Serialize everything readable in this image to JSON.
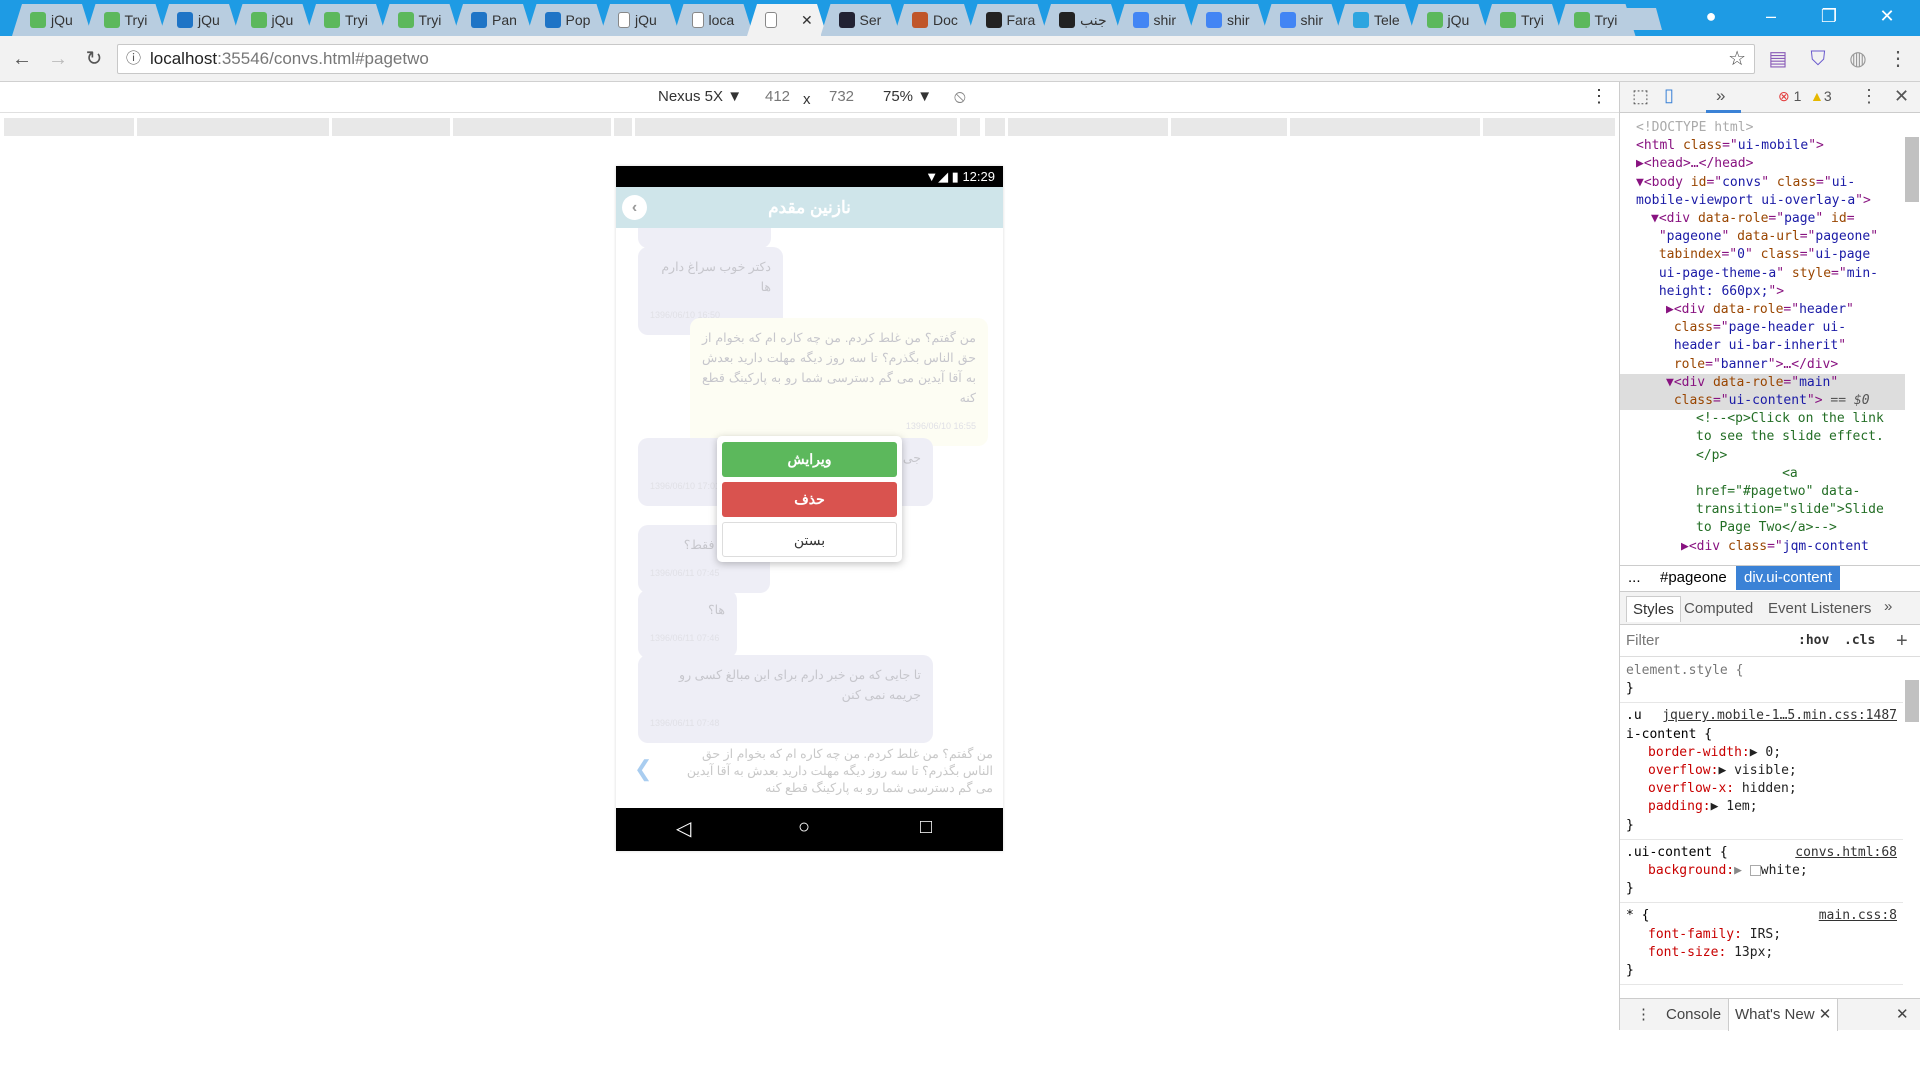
{
  "browser": {
    "tabs": [
      {
        "label": "jQu",
        "icon": "w3",
        "color": "#5cb85c"
      },
      {
        "label": "Tryi",
        "icon": "w3",
        "color": "#5cb85c"
      },
      {
        "label": "jQu",
        "icon": "jquery",
        "color": "#1e74c6"
      },
      {
        "label": "jQu",
        "icon": "w3",
        "color": "#5cb85c"
      },
      {
        "label": "Tryi",
        "icon": "w3",
        "color": "#5cb85c"
      },
      {
        "label": "Tryi",
        "icon": "w3",
        "color": "#5cb85c"
      },
      {
        "label": "Pan",
        "icon": "jquery",
        "color": "#1e74c6"
      },
      {
        "label": "Pop",
        "icon": "jquery",
        "color": "#1e74c6"
      },
      {
        "label": "jQu",
        "icon": "page",
        "color": "#888"
      },
      {
        "label": "loca",
        "icon": "page",
        "color": "#888"
      },
      {
        "label": "",
        "icon": "page",
        "color": "#888",
        "active": true
      },
      {
        "label": "Ser",
        "icon": "sentry",
        "color": "#223"
      },
      {
        "label": "Doc",
        "icon": "doc",
        "color": "#c0562a"
      },
      {
        "label": "Fara",
        "icon": "eye",
        "color": "#222"
      },
      {
        "label": "جنب",
        "icon": "eye",
        "color": "#222"
      },
      {
        "label": "shir",
        "icon": "google",
        "color": "#4285f4"
      },
      {
        "label": "shir",
        "icon": "google",
        "color": "#4285f4"
      },
      {
        "label": "shir",
        "icon": "google",
        "color": "#4285f4"
      },
      {
        "label": "Tele",
        "icon": "telegram",
        "color": "#2ca5e0"
      },
      {
        "label": "jQu",
        "icon": "w3",
        "color": "#5cb85c"
      },
      {
        "label": "Tryi",
        "icon": "w3",
        "color": "#5cb85c"
      },
      {
        "label": "Tryi",
        "icon": "w3",
        "color": "#5cb85c"
      }
    ],
    "url_host": "localhost",
    "url_rest": ":35546/convs.html#pagetwo"
  },
  "device_toolbar": {
    "device": "Nexus 5X",
    "width": "412",
    "x": "x",
    "height": "732",
    "zoom": "75%"
  },
  "phone": {
    "time": "12:29",
    "title": "نازنین مقدم",
    "messages": [
      {
        "text": "دکتر خوب سراغ دارم ها",
        "time": "1396/06/10 16:50",
        "mine": false
      },
      {
        "text": "من گفتم؟ من غلط کردم. من چه کاره ام که بخوام از حق الناس بگذرم؟ تا سه روز دیگه مهلت دارید بعدش به آقا آیدین می گم دسترسی شما رو به پارکینگ قطع کنه",
        "time": "1396/06/10 16:55",
        "mine": true
      },
      {
        "text": "جی ... هزار تومن بدهی",
        "time": "1396/06/10 17:01",
        "mine": false
      },
      {
        "text": "... تومن فقط؟",
        "time": "1396/06/11 07:45",
        "mine": false
      },
      {
        "text": "ها؟",
        "time": "1396/06/11 07:46",
        "mine": false
      },
      {
        "text": "تا جایی که من خبر دارم برای این مبالغ کسی رو جریمه نمی کنن",
        "time": "1396/06/11 07:48",
        "mine": false
      }
    ],
    "compose_text": "من گفتم؟ من غلط کردم. من چه کاره ام که بخوام از حق الناس بگذرم؟ تا سه روز دیگه مهلت دارید بعدش به آقا آیدین می گم دسترسی شما رو به پارکینگ قطع کنه",
    "popup": {
      "edit": "ویرایش",
      "delete": "حذف",
      "close": "بستن",
      "edit_color": "#5cb85c",
      "delete_color": "#d9534f"
    }
  },
  "devtools": {
    "errors": "1",
    "warnings": "3",
    "elements": [
      {
        "i": 0,
        "h": "<span style='color:#aaa'>&lt;!DOCTYPE html&gt;</span>"
      },
      {
        "i": 0,
        "h": "&lt;html <span class=at>class</span>=\"<span class=av>ui-mobile</span>\"&gt;"
      },
      {
        "i": 0,
        "h": "▶&lt;head&gt;…&lt;/head&gt;"
      },
      {
        "i": 0,
        "h": "▼&lt;body <span class=at>id</span>=\"<span class=av>convs</span>\" <span class=at>class</span>=\"<span class=av>ui-</span>"
      },
      {
        "i": 0,
        "h": "<span class=av>mobile-viewport ui-overlay-a</span>\"&gt;"
      },
      {
        "i": 1,
        "h": "▼&lt;div <span class=at>data-role</span>=\"<span class=av>page</span>\" <span class=at>id</span>="
      },
      {
        "i": 1,
        "h": " \"<span class=av>pageone</span>\" <span class=at>data-url</span>=\"<span class=av>pageone</span>\""
      },
      {
        "i": 1,
        "h": " <span class=at>tabindex</span>=\"<span class=av>0</span>\" <span class=at>class</span>=\"<span class=av>ui-page</span>"
      },
      {
        "i": 1,
        "h": " <span class=av>ui-page-theme-a</span>\" <span class=at>style</span>=\"<span class=av>min-</span>"
      },
      {
        "i": 1,
        "h": " <span class=av>height: 660px;</span>\"&gt;"
      },
      {
        "i": 2,
        "h": "▶&lt;div <span class=at>data-role</span>=\"<span class=av>header</span>\""
      },
      {
        "i": 2,
        "h": " <span class=at>class</span>=\"<span class=av>page-header ui-</span>"
      },
      {
        "i": 2,
        "h": " <span class=av>header ui-bar-inherit</span>\""
      },
      {
        "i": 2,
        "h": " <span class=at>role</span>=\"<span class=av>banner</span>\"&gt;…&lt;/div&gt;"
      },
      {
        "i": 2,
        "h": "▼&lt;div <span class=at>data-role</span>=\"<span class=av>main</span>\"",
        "sel": true
      },
      {
        "i": 2,
        "h": " <span class=at>class</span>=\"<span class=av>ui-content</span>\"&gt; <span style='color:#555'>== <i>$0</i></span>",
        "sel": true
      },
      {
        "i": 4,
        "h": "<span class=cm>&lt;!--&lt;p&gt;Click on the link</span>"
      },
      {
        "i": 4,
        "h": "<span class=cm>to see the slide effect.</span>"
      },
      {
        "i": 4,
        "h": "<span class=cm>&lt;/p&gt;</span>"
      },
      {
        "i": 4,
        "h": "<span class=cm>           &lt;a</span>"
      },
      {
        "i": 4,
        "h": "<span class=cm>href=\"#pagetwo\" data-</span>"
      },
      {
        "i": 4,
        "h": "<span class=cm>transition=\"slide\"&gt;Slide</span>"
      },
      {
        "i": 4,
        "h": "<span class=cm>to Page Two&lt;/a&gt;--&gt;</span>"
      },
      {
        "i": 3,
        "h": "▶&lt;div <span class=at>class</span>=\"<span class=av>jqm-content</span>"
      }
    ],
    "crumbs": {
      "more": "...",
      "c1": "#pageone",
      "c2": "div.ui-content"
    },
    "style_tabs": {
      "styles": "Styles",
      "computed": "Computed",
      "listeners": "Event Listeners"
    },
    "filter": {
      "placeholder": "Filter",
      "hov": ":hov",
      "cls": ".cls"
    },
    "rules": {
      "el": "element.style {",
      "r1_sel_a": ".u",
      "r1_src": "jquery.mobile-1…5.min.css:1487",
      "r1_sel_b": "i-content {",
      "r1_p1": "border-width:",
      "r1_v1": "▶ 0;",
      "r1_p2": "overflow:",
      "r1_v2": "▶ visible;",
      "r1_p3": "overflow-x:",
      "r1_v3": " hidden;",
      "r1_p4": "padding:",
      "r1_v4": "▶ 1em;",
      "r2_sel": ".ui-content {",
      "r2_src": "convs.html:68",
      "r2_p1": "background:",
      "r2_v1": "white;",
      "r3_sel": "* {",
      "r3_src": "main.css:8",
      "r3_p1": "font-family:",
      "r3_v1": " IRS;",
      "r3_p2": "font-size:",
      "r3_v2": " 13px;",
      "close": "}"
    },
    "drawer": {
      "console": "Console",
      "whatsnew": "What's New"
    }
  }
}
